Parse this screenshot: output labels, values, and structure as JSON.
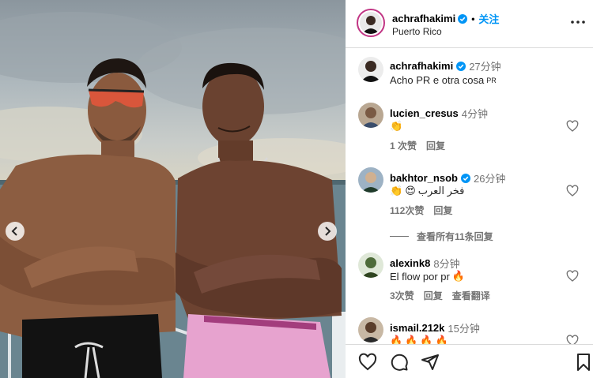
{
  "header": {
    "username": "achrafhakimi",
    "separator": "•",
    "follow_label": "关注",
    "location": "Puerto Rico"
  },
  "caption": {
    "username": "achrafhakimi",
    "time": "27分钟",
    "text": "Acho PR e otra cosa",
    "text_suffix": "PR"
  },
  "comments": [
    {
      "username": "lucien_cresus",
      "time": "4分钟",
      "text": "",
      "emojis": [
        "clapping-hands"
      ],
      "likes": "1 次赞",
      "reply": "回复",
      "verified": false
    },
    {
      "username": "bakhtor_nsob",
      "time": "26分钟",
      "text": "فخر العرب",
      "emojis": [
        "clapping-hands",
        "heart-eyes"
      ],
      "likes": "112次赞",
      "reply": "回复",
      "verified": true
    },
    {
      "username": "alexink8",
      "time": "8分钟",
      "text": "El flow por pr",
      "emojis": [
        "fire"
      ],
      "likes": "3次赞",
      "reply": "回复",
      "translate": "查看翻译",
      "verified": false
    },
    {
      "username": "ismail.212k",
      "time": "15分钟",
      "text": "",
      "emojis": [
        "fire",
        "fire",
        "fire",
        "fire"
      ],
      "verified": false
    }
  ],
  "view_replies": "查看所有11条回复",
  "actions": [
    "heart-icon",
    "comment-icon",
    "share-icon",
    "bookmark-icon"
  ],
  "colors": {
    "accent": "#0095f6",
    "verified": "#0095f6",
    "muted": "#737373"
  }
}
